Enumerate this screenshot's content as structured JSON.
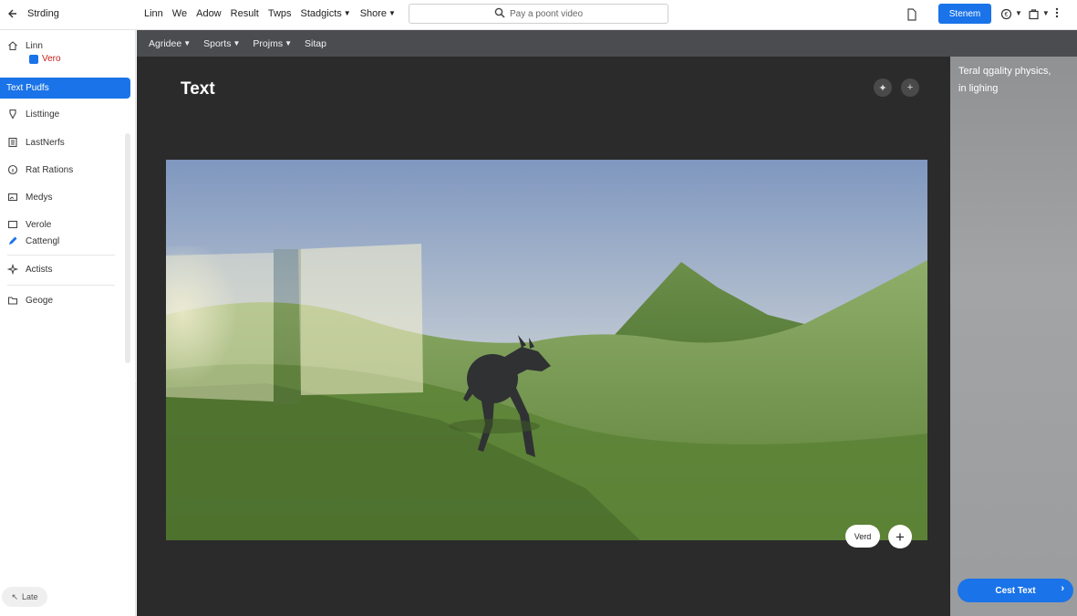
{
  "topbar": {
    "brand": "Strding",
    "nav": [
      "Linn",
      "We",
      "Adow",
      "Result",
      "Twps"
    ],
    "nav_dropdowns": [
      "Stadgicts",
      "Shore"
    ],
    "search_placeholder": "Pay a poont video",
    "signin_label": "Stenem"
  },
  "sidebar": {
    "home_label": "Linn",
    "sub_label": "Vero",
    "active_label": "Text Pudfs",
    "items": [
      "Listtinge",
      "LastNerfs",
      "Rat Rations",
      "Medys",
      "Verole",
      "Cattengl",
      "Actists",
      "Geoge"
    ],
    "footer_label": "Late"
  },
  "subbar": {
    "menus": [
      "Agridee",
      "Sports",
      "Projms"
    ],
    "plain": "Sitap"
  },
  "main": {
    "title": "Text",
    "pill_label": "Verd"
  },
  "right_panel": {
    "lines": [
      "Teral qgality physics,",
      "in lighing"
    ],
    "cta_label": "Cest Text"
  },
  "colors": {
    "accent": "#1a73e8",
    "main_bg": "#2b2b2b",
    "subbar_bg": "#4a4c4f",
    "panel_bg": "#9a9c9e"
  },
  "icons": {
    "back": "arrow-left-icon",
    "search": "search-icon",
    "doc": "document-icon",
    "help": "help-circle-icon",
    "bag": "bag-icon",
    "more": "more-vert-icon"
  }
}
